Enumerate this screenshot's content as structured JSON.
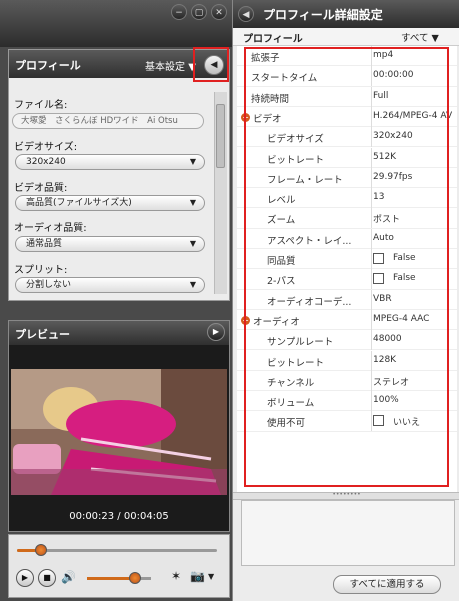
{
  "left": {
    "window_controls": [
      "−",
      "▢",
      "✕"
    ],
    "profile_panel": {
      "title": "プロフィール",
      "preset": "基本設定",
      "filename_label": "ファイル名:",
      "filename_value": "大塚愛　さくらんぼ HDワイド　Ai Otsu",
      "video_size_label": "ビデオサイズ:",
      "video_size_value": "320x240",
      "video_quality_label": "ビデオ品質:",
      "video_quality_value": "高品質(ファイルサイズ大)",
      "audio_quality_label": "オーディオ品質:",
      "audio_quality_value": "通常品質",
      "split_label": "スプリット:",
      "split_value": "分割しない"
    },
    "preview": {
      "title": "プレビュー",
      "timecode": "00:00:23 / 00:04:05"
    }
  },
  "right": {
    "title": "プロフィール詳細設定",
    "header_label": "プロフィール",
    "filter_label": "すべて",
    "rows": [
      {
        "label": "拡張子",
        "value": "mp4",
        "indent": 0
      },
      {
        "label": "スタートタイム",
        "value": "00:00:00",
        "indent": 0
      },
      {
        "label": "持続時間",
        "value": "Full",
        "indent": 0
      },
      {
        "label": "ビデオ",
        "value": "H.264/MPEG-4 AV",
        "indent": 0,
        "group": true
      },
      {
        "label": "ビデオサイズ",
        "value": "320x240",
        "indent": 1
      },
      {
        "label": "ビットレート",
        "value": "512K",
        "indent": 1
      },
      {
        "label": "フレーム・レート",
        "value": "29.97fps",
        "indent": 1
      },
      {
        "label": "レベル",
        "value": "13",
        "indent": 1
      },
      {
        "label": "ズーム",
        "value": "ポスト",
        "indent": 1
      },
      {
        "label": "アスペクト・レイ...",
        "value": "Auto",
        "indent": 1
      },
      {
        "label": "同品質",
        "value": "False",
        "indent": 1,
        "checkbox": true
      },
      {
        "label": "2-パス",
        "value": "False",
        "indent": 1,
        "checkbox": true
      },
      {
        "label": "オーディオコーデ...",
        "value": "VBR",
        "indent": 1
      },
      {
        "label": "オーディオ",
        "value": "MPEG-4 AAC",
        "indent": 0,
        "group": true
      },
      {
        "label": "サンプルレート",
        "value": "48000",
        "indent": 1
      },
      {
        "label": "ビットレート",
        "value": "128K",
        "indent": 1
      },
      {
        "label": "チャンネル",
        "value": "ステレオ",
        "indent": 1
      },
      {
        "label": "ボリューム",
        "value": "100%",
        "indent": 1
      },
      {
        "label": "使用不可",
        "value": "いいえ",
        "indent": 1,
        "checkbox": true
      }
    ],
    "apply_button": "すべてに適用する"
  },
  "colors": {
    "highlight": "#e02020",
    "group_icon": "#d45a1c",
    "titlebar": "#3a3a3a"
  }
}
